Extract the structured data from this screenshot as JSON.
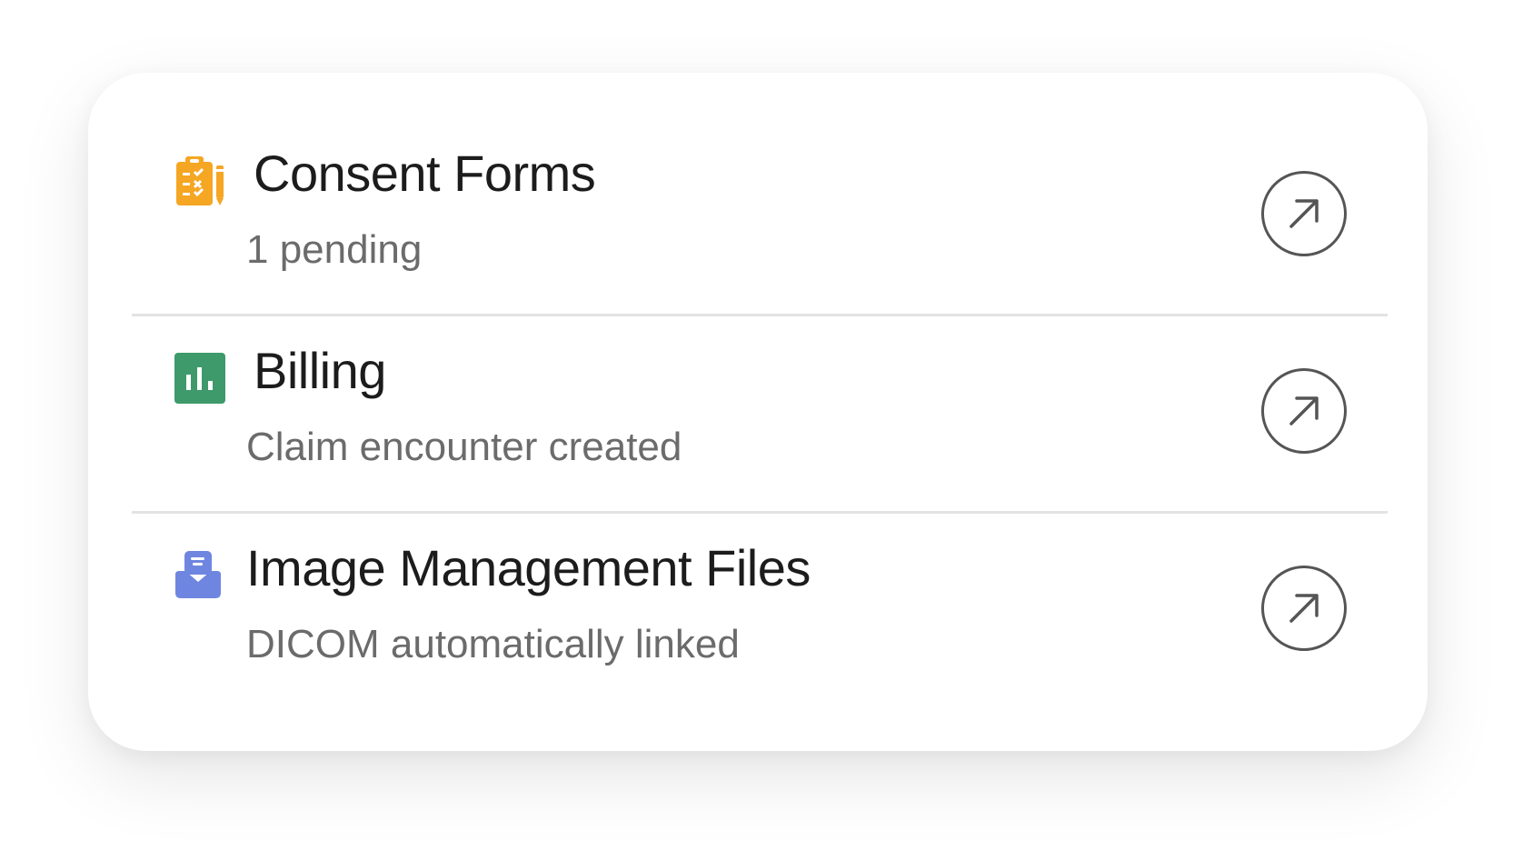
{
  "items": [
    {
      "title": "Consent Forms",
      "subtitle": "1 pending",
      "icon": "clipboard-checklist-icon",
      "icon_color": "#F5A623",
      "action_icon": "arrow-up-right-icon"
    },
    {
      "title": "Billing",
      "subtitle": "Claim encounter created",
      "icon": "bar-chart-icon",
      "icon_color": "#3E9A6B",
      "action_icon": "arrow-up-right-icon"
    },
    {
      "title": "Image Management Files",
      "subtitle": "DICOM automatically linked",
      "icon": "inbox-tray-icon",
      "icon_color": "#6F86E0",
      "action_icon": "arrow-up-right-icon"
    }
  ]
}
